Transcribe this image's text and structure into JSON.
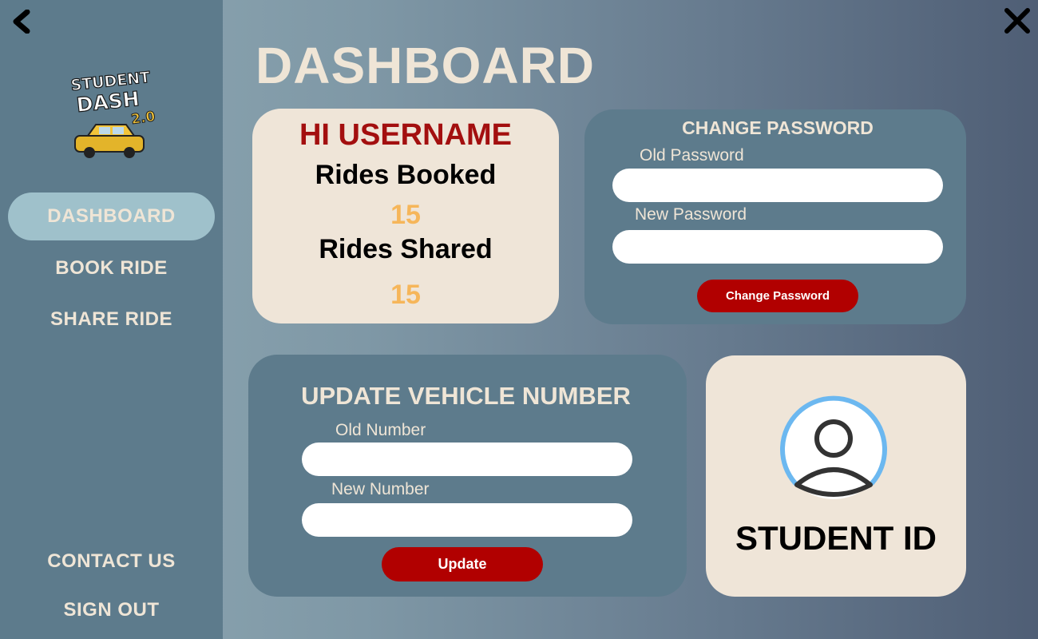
{
  "app": {
    "title": "DASHBOARD",
    "logo_text": [
      "STUDENT",
      "DASH",
      "2.0"
    ]
  },
  "sidebar": {
    "items": [
      {
        "label": "DASHBOARD",
        "active": true
      },
      {
        "label": "BOOK RIDE",
        "active": false
      },
      {
        "label": "SHARE RIDE",
        "active": false
      }
    ],
    "bottom_items": [
      {
        "label": "CONTACT US"
      },
      {
        "label": "SIGN OUT"
      }
    ]
  },
  "greeting": {
    "hello": "HI USERNAME",
    "rides_booked_label": "Rides Booked",
    "rides_booked_value": "15",
    "rides_shared_label": "Rides Shared",
    "rides_shared_value": "15"
  },
  "change_password": {
    "title": "CHANGE PASSWORD",
    "old_label": "Old Password",
    "old_value": "",
    "new_label": "New Password",
    "new_value": "",
    "button_label": "Change Password"
  },
  "update_vehicle": {
    "title": "UPDATE VEHICLE NUMBER",
    "old_label": "Old Number",
    "old_value": "",
    "new_label": "New Number",
    "new_value": "",
    "button_label": "Update"
  },
  "student_card": {
    "label": "STUDENT ID"
  },
  "colors": {
    "sidebar": "#5d7b8c",
    "nav_active": "#9fc1cb",
    "cream": "#efe5d8",
    "accent_red": "#b10000",
    "greeting_red": "#a30f0f",
    "stat_orange": "#f6b65a",
    "avatar_ring": "#6cb8f0"
  },
  "icons": {
    "back": "chevron-left-icon",
    "close": "close-icon",
    "avatar": "user-avatar-icon"
  }
}
